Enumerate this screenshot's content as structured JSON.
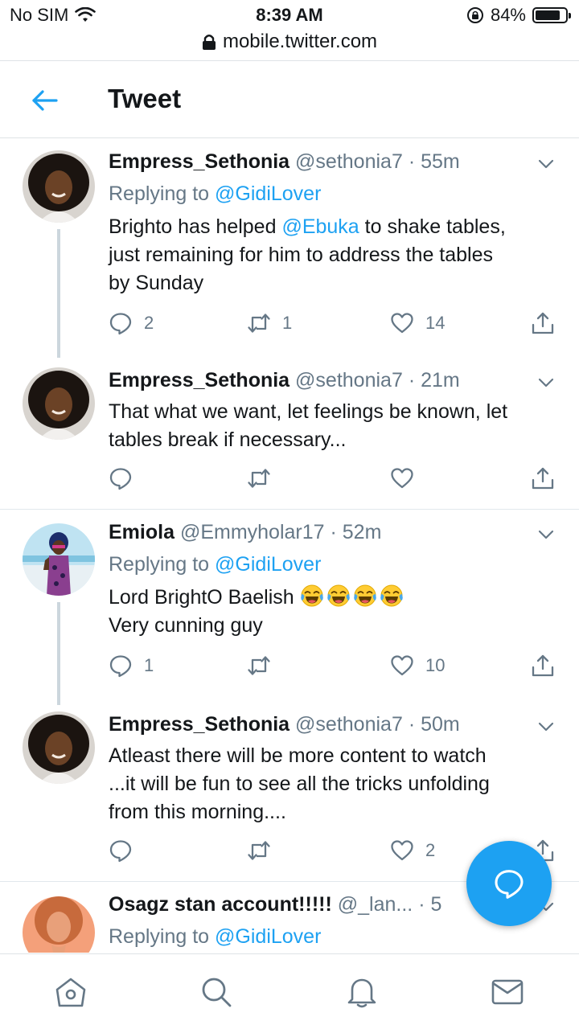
{
  "status_bar": {
    "carrier": "No SIM",
    "time": "8:39 AM",
    "battery_percent": "84%",
    "battery_level": 0.84,
    "url": "mobile.twitter.com"
  },
  "header": {
    "title": "Tweet"
  },
  "tweets": [
    {
      "name": "Empress_Sethonia",
      "handle": "@sethonia7",
      "dot": "·",
      "time": "55m",
      "replying_prefix": "Replying to",
      "replying_to": "@GidiLover",
      "text_parts": [
        "Brighto has helped ",
        "@Ebuka",
        " to shake tables,",
        "just remaining for him to address the tables",
        "by Sunday"
      ],
      "replies": "2",
      "retweets": "1",
      "likes": "14"
    },
    {
      "name": "Empress_Sethonia",
      "handle": "@sethonia7",
      "dot": "·",
      "time": "21m",
      "text_lines": [
        "That what we want, let feelings be known, let",
        "tables break if necessary..."
      ],
      "replies": "",
      "retweets": "",
      "likes": ""
    },
    {
      "name": "Emiola",
      "handle": "@Emmyholar17",
      "dot": "·",
      "time": "52m",
      "replying_prefix": "Replying to",
      "replying_to": "@GidiLover",
      "text_lines": [
        "Lord BrightO Baelish ",
        "Very cunning guy"
      ],
      "emoji": [
        "face-with-tears-of-joy-emoji",
        "face-with-tears-of-joy-emoji",
        "face-with-tears-of-joy-emoji",
        "face-with-tears-of-joy-emoji"
      ],
      "replies": "1",
      "retweets": "",
      "likes": "10"
    },
    {
      "name": "Empress_Sethonia",
      "handle": "@sethonia7",
      "dot": "·",
      "time": "50m",
      "text_lines": [
        "Atleast there will be more content to watch",
        "...it will be fun to see all the tricks unfolding",
        "from this morning...."
      ],
      "replies": "",
      "retweets": "",
      "likes": "2"
    },
    {
      "name": "Osagz stan account!!!!!",
      "handle": "@_lan...",
      "dot": "·",
      "time": "5",
      "replying_prefix": "Replying to",
      "replying_to": "@GidiLover"
    }
  ],
  "icons": {
    "back": "arrow-left-icon",
    "reply": "reply-icon",
    "retweet": "retweet-icon",
    "like": "heart-icon",
    "share": "share-icon",
    "compose": "compose-message-icon",
    "home": "home-icon",
    "search": "search-icon",
    "notifications": "bell-icon",
    "messages": "mail-icon"
  },
  "colors": {
    "accent": "#1da1f2",
    "muted": "#657786",
    "text": "#14171a"
  }
}
